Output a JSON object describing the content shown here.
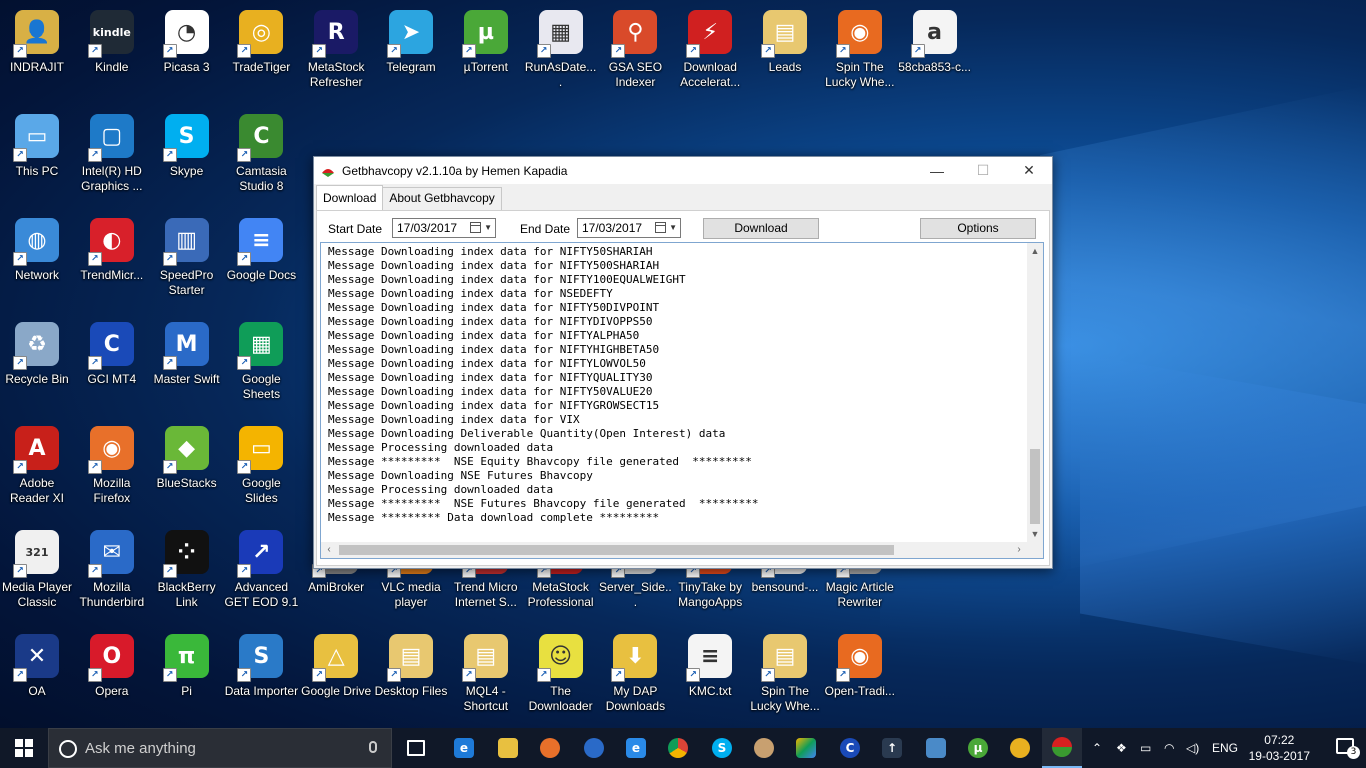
{
  "desktop": {
    "icons": [
      {
        "label": "INDRAJIT",
        "glyph": "👤",
        "color": "#d8b045"
      },
      {
        "label": "Kindle",
        "glyph": "kindle",
        "color": "#1f2a36"
      },
      {
        "label": "Picasa 3",
        "glyph": "◔",
        "color": "#ffffff"
      },
      {
        "label": "TradeTiger",
        "glyph": "◎",
        "color": "#e8b020"
      },
      {
        "label": "MetaStock Refresher",
        "glyph": "R",
        "color": "#1a1a66"
      },
      {
        "label": "Telegram",
        "glyph": "➤",
        "color": "#2ca5e0"
      },
      {
        "label": "µTorrent",
        "glyph": "µ",
        "color": "#4aa838"
      },
      {
        "label": "RunAsDate....",
        "glyph": "▦",
        "color": "#e8e8f0"
      },
      {
        "label": "GSA SEO Indexer",
        "glyph": "⚲",
        "color": "#d94a2a"
      },
      {
        "label": "Download Accelerat...",
        "glyph": "⚡",
        "color": "#d02020"
      },
      {
        "label": "Leads",
        "glyph": "▤",
        "color": "#e8c870"
      },
      {
        "label": "Spin The Lucky Whe...",
        "glyph": "◉",
        "color": "#e86a20"
      },
      {
        "label": "58cba853-c...",
        "glyph": "a",
        "color": "#f4f4f4"
      },
      {
        "label": "This PC",
        "glyph": "▭",
        "color": "#5aa8e8"
      },
      {
        "label": "Intel(R) HD Graphics ...",
        "glyph": "▢",
        "color": "#1e7ac8"
      },
      {
        "label": "Skype",
        "glyph": "S",
        "color": "#00aff0"
      },
      {
        "label": "Camtasia Studio 8",
        "glyph": "C",
        "color": "#3a8a30"
      },
      {
        "label": "Network",
        "glyph": "◍",
        "color": "#3a8ad8"
      },
      {
        "label": "TrendMicr...",
        "glyph": "◐",
        "color": "#d8202a"
      },
      {
        "label": "SpeedPro Starter",
        "glyph": "▥",
        "color": "#3a6ab8"
      },
      {
        "label": "Google Docs",
        "glyph": "≡",
        "color": "#4285f4"
      },
      {
        "label": "Recycle Bin",
        "glyph": "♻",
        "color": "#8aa8c8"
      },
      {
        "label": "GCI MT4",
        "glyph": "C",
        "color": "#1a4ab8"
      },
      {
        "label": "Master Swift",
        "glyph": "M",
        "color": "#2a6ac8"
      },
      {
        "label": "Google Sheets",
        "glyph": "▦",
        "color": "#0f9d58"
      },
      {
        "label": "Adobe Reader XI",
        "glyph": "A",
        "color": "#c8201a"
      },
      {
        "label": "Mozilla Firefox",
        "glyph": "◉",
        "color": "#e8702a"
      },
      {
        "label": "BlueStacks",
        "glyph": "◆",
        "color": "#6ab838"
      },
      {
        "label": "Google Slides",
        "glyph": "▭",
        "color": "#f4b400"
      },
      {
        "label": "Media Player Classic",
        "glyph": "321",
        "color": "#f0f0f0"
      },
      {
        "label": "Mozilla Thunderbird",
        "glyph": "✉",
        "color": "#2a6ac8"
      },
      {
        "label": "BlackBerry Link",
        "glyph": "⁘",
        "color": "#111111"
      },
      {
        "label": "Advanced GET EOD 9.1",
        "glyph": "↗",
        "color": "#1a3ab8"
      },
      {
        "label": "AmiBroker",
        "glyph": "A",
        "color": "#888888"
      },
      {
        "label": "VLC media player",
        "glyph": "▲",
        "color": "#e8801a"
      },
      {
        "label": "Trend Micro Internet S...",
        "glyph": "▣",
        "color": "#c83030"
      },
      {
        "label": "MetaStock Professional",
        "glyph": "M",
        "color": "#c82020"
      },
      {
        "label": "Server_Side...",
        "glyph": "▯",
        "color": "#dddddd"
      },
      {
        "label": "TinyTake by MangoApps",
        "glyph": "◎",
        "color": "#e84a1a"
      },
      {
        "label": "bensound-...",
        "glyph": "◌",
        "color": "#eeeeee"
      },
      {
        "label": "Magic Article Rewriter",
        "glyph": "◒",
        "color": "#aaaaaa"
      },
      {
        "label": "OA",
        "glyph": "✕",
        "color": "#1a3a88"
      },
      {
        "label": "Opera",
        "glyph": "O",
        "color": "#d81a2a"
      },
      {
        "label": "Pi",
        "glyph": "π",
        "color": "#3ab83a"
      },
      {
        "label": "Data Importer",
        "glyph": "S",
        "color": "#2a7ac8"
      },
      {
        "label": "Google Drive",
        "glyph": "△",
        "color": "#e8c040"
      },
      {
        "label": "Desktop Files",
        "glyph": "▤",
        "color": "#e8c870"
      },
      {
        "label": "MQL4 - Shortcut",
        "glyph": "▤",
        "color": "#e8c870"
      },
      {
        "label": "The Downloader",
        "glyph": "☺",
        "color": "#e8e040"
      },
      {
        "label": "My DAP Downloads",
        "glyph": "⬇",
        "color": "#e8c040"
      },
      {
        "label": "KMC.txt",
        "glyph": "≡",
        "color": "#f4f4f4"
      },
      {
        "label": "Spin The Lucky Whe...",
        "glyph": "▤",
        "color": "#e8c870"
      },
      {
        "label": "Open-Tradi...",
        "glyph": "◉",
        "color": "#e86a20"
      }
    ]
  },
  "window": {
    "title": "Getbhavcopy v2.1.10a by Hemen Kapadia",
    "minimize": "—",
    "maximize": "☐",
    "close": "✕",
    "tabs": [
      "Download",
      "About Getbhavcopy"
    ],
    "start_date_label": "Start Date",
    "start_date_value": "17/03/2017",
    "end_date_label": "End Date",
    "end_date_value": "17/03/2017",
    "download_button": "Download",
    "options_button": "Options",
    "log": [
      "Message Downloading index data for NIFTY50SHARIAH",
      "Message Downloading index data for NIFTY500SHARIAH",
      "Message Downloading index data for NIFTY100EQUALWEIGHT",
      "Message Downloading index data for NSEDEFTY",
      "Message Downloading index data for NIFTY50DIVPOINT",
      "Message Downloading index data for NIFTYDIVOPPS50",
      "Message Downloading index data for NIFTYALPHA50",
      "Message Downloading index data for NIFTYHIGHBETA50",
      "Message Downloading index data for NIFTYLOWVOL50",
      "Message Downloading index data for NIFTYQUALITY30",
      "Message Downloading index data for NIFTY50VALUE20",
      "Message Downloading index data for NIFTYGROWSECT15",
      "Message Downloading index data for VIX",
      "Message Downloading Deliverable Quantity(Open Interest) data",
      "Message Processing downloaded data",
      "Message *********  NSE Equity Bhavcopy file generated  *********",
      "Message Downloading NSE Futures Bhavcopy",
      "Message Processing downloaded data",
      "Message *********  NSE Futures Bhavcopy file generated  *********",
      "Message ********* Data download complete *********"
    ]
  },
  "taskbar": {
    "search_placeholder": "Ask me anything",
    "language": "ENG",
    "time": "07:22",
    "date": "19-03-2017",
    "notification_count": "3"
  }
}
